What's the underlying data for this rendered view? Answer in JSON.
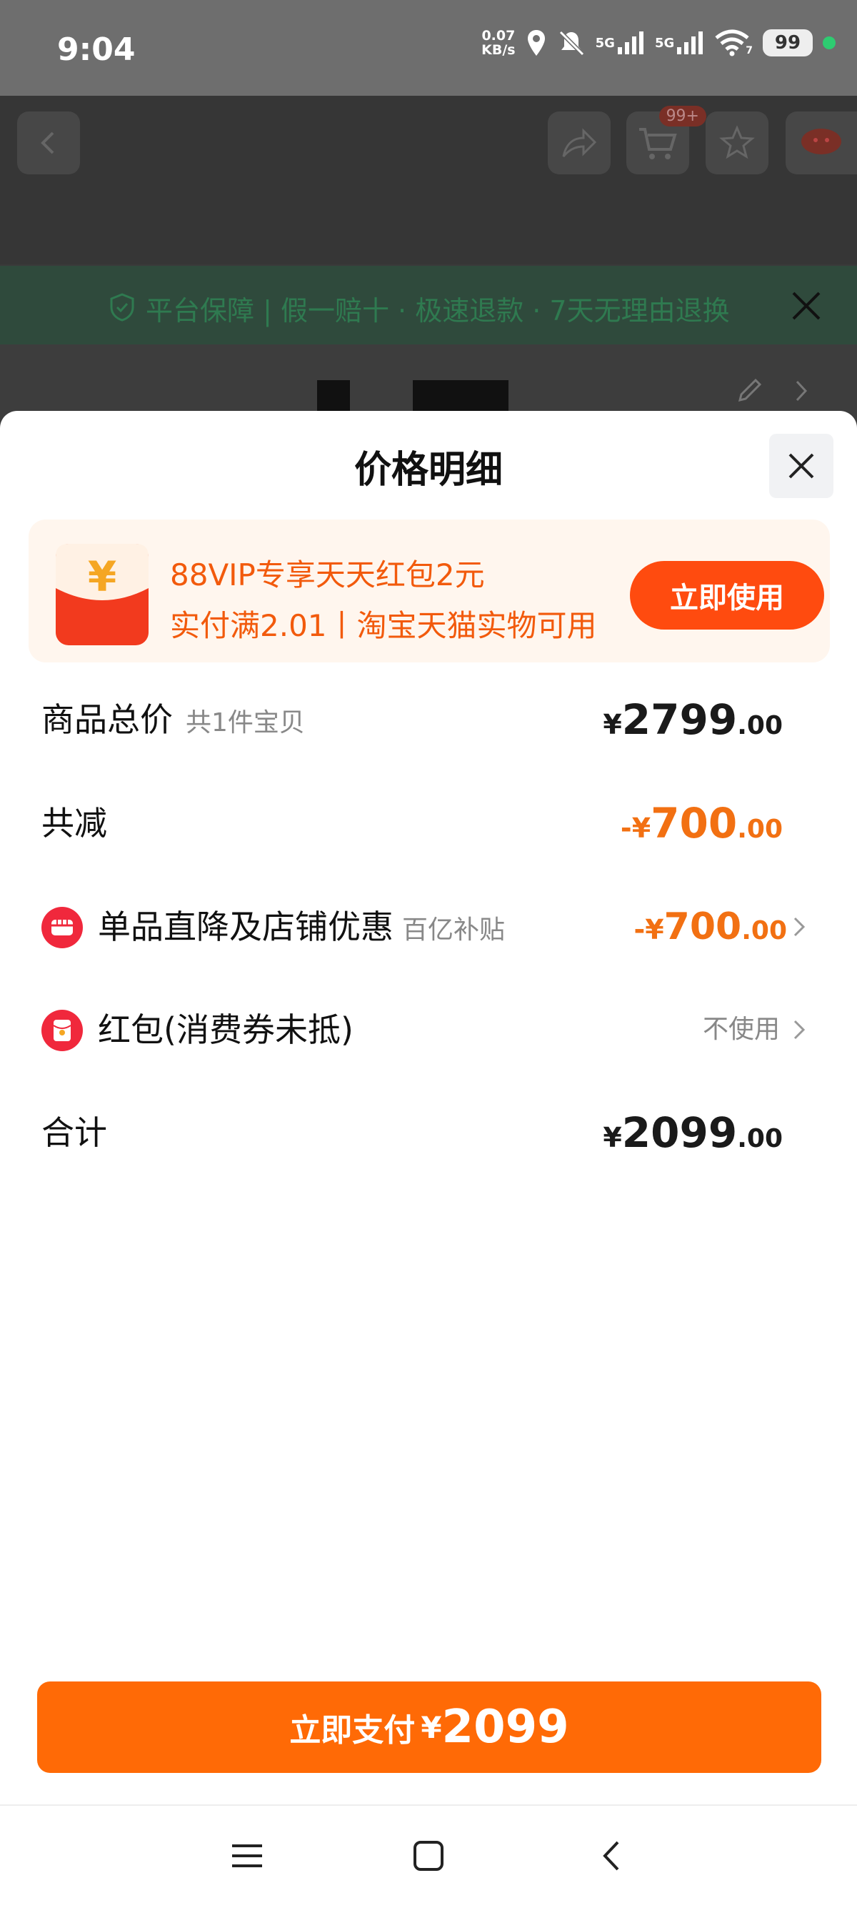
{
  "status_bar": {
    "time": "9:04",
    "net_speed_value": "0.07",
    "net_speed_unit": "KB/s",
    "signal_1": "5G",
    "signal_2": "5G",
    "wifi_sub": "7",
    "battery": "99"
  },
  "background": {
    "cart_badge": "99+",
    "guarantee_text": "平台保障 | 假一赔十 · 极速退款 · 7天无理由退换"
  },
  "sheet": {
    "title": "价格明细",
    "promo": {
      "envelope_symbol": "¥",
      "line1": "88VIP专享天天红包2元",
      "line2": "实付满2.01丨淘宝天猫实物可用",
      "button": "立即使用"
    },
    "rows": {
      "total": {
        "label": "商品总价",
        "sub": "共1件宝贝",
        "currency": "¥",
        "int": "2799",
        "dec": ".00"
      },
      "reduce": {
        "label": "共减",
        "currency": "-¥",
        "int": "700",
        "dec": ".00"
      },
      "discount": {
        "label": "单品直降及店铺优惠",
        "sub": "百亿补贴",
        "currency": "-¥",
        "int": "700",
        "dec": ".00"
      },
      "redpacket": {
        "label": "红包(消费券未抵)",
        "value": "不使用"
      },
      "sum": {
        "label": "合计",
        "currency": "¥",
        "int": "2099",
        "dec": ".00"
      }
    },
    "pay_button": {
      "label": "立即支付",
      "currency": "¥",
      "value": "2099"
    }
  },
  "colors": {
    "accent_orange": "#ff6a06",
    "promo_orange": "#f25a0c",
    "discount_orange": "#f27012",
    "icon_red": "#f0283c"
  }
}
